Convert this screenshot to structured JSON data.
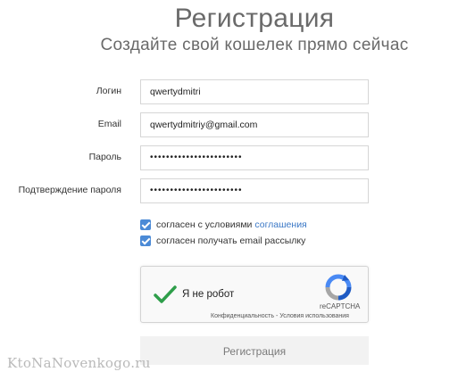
{
  "header": {
    "title": "Регистрация",
    "subtitle": "Создайте свой кошелек прямо сейчас"
  },
  "form": {
    "login": {
      "label": "Логин",
      "value": "qwertydmitri"
    },
    "email": {
      "label": "Email",
      "value": "qwertydmitriy@gmail.com"
    },
    "password": {
      "label": "Пароль",
      "value": "•••••••••••••••••••••••"
    },
    "password_confirm": {
      "label": "Подтверждение пароля",
      "value": "•••••••••••••••••••••••"
    },
    "agree_terms": {
      "text": "согласен с условиями",
      "link": "соглашения",
      "checked": true
    },
    "agree_mailing": {
      "text": "согласен получать email рассылку",
      "checked": true
    },
    "submit_label": "Регистрация"
  },
  "captcha": {
    "label": "Я не робот",
    "brand": "reCAPTCHA",
    "privacy": "Конфиденциальность",
    "separator": " - ",
    "terms": "Условия использования",
    "checked": true
  },
  "watermark": "KtoNaNovenkogo.ru",
  "colors": {
    "checkbox": "#4b8ad6",
    "link": "#3b78c6",
    "check_tick": "#2e9e4a"
  }
}
